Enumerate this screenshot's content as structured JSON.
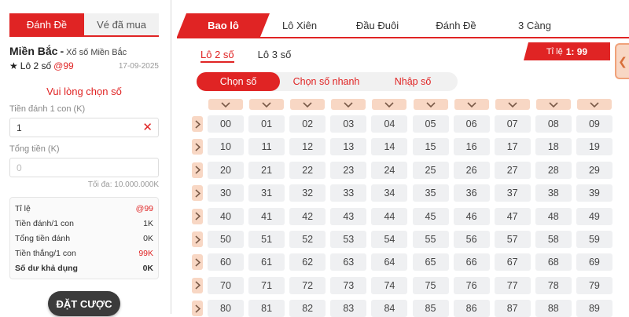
{
  "left": {
    "tabs": [
      {
        "label": "Đánh Đề",
        "active": true
      },
      {
        "label": "Vé đã mua",
        "active": false
      }
    ],
    "region": {
      "name": "Miền Bắc",
      "dash": "-",
      "sub": "Xổ số Miền Bắc"
    },
    "bet_type": {
      "star": "★",
      "label": "Lô 2 số",
      "rate": "@99",
      "date": "17-09-2025"
    },
    "prompt": "Vui lòng chọn số",
    "stake": {
      "label": "Tiền đánh 1 con (K)",
      "value": "1"
    },
    "total": {
      "label": "Tổng tiền (K)",
      "placeholder": "0"
    },
    "max_note": "Tối đa: 10.000.000K",
    "summary": [
      {
        "label": "Tỉ lệ",
        "value": "@99",
        "red": true,
        "bold": false
      },
      {
        "label": "Tiền đánh/1 con",
        "value": "1K",
        "red": false,
        "bold": false
      },
      {
        "label": "Tổng tiền đánh",
        "value": "0K",
        "red": false,
        "bold": false
      },
      {
        "label": "Tiền thắng/1 con",
        "value": "99K",
        "red": true,
        "bold": false
      },
      {
        "label": "Số dư khả dụng",
        "value": "0K",
        "red": false,
        "bold": true
      }
    ],
    "bet_button": "ĐẶT CƯỢC"
  },
  "nav": {
    "tabs": [
      "Bao lô",
      "Lô Xiên",
      "Đầu Đuôi",
      "Đánh Đề",
      "3 Càng"
    ],
    "active": 0
  },
  "subtabs": {
    "items": [
      "Lô 2 số",
      "Lô 3 số"
    ],
    "active": 0
  },
  "ratio": {
    "label": "Tỉ lệ",
    "value": "1: 99"
  },
  "modes": {
    "items": [
      "Chọn số",
      "Chọn số nhanh",
      "Nhập số"
    ],
    "active": 0
  },
  "grid": {
    "rows": [
      [
        "00",
        "01",
        "02",
        "03",
        "04",
        "05",
        "06",
        "07",
        "08",
        "09"
      ],
      [
        "10",
        "11",
        "12",
        "13",
        "14",
        "15",
        "16",
        "17",
        "18",
        "19"
      ],
      [
        "20",
        "21",
        "22",
        "23",
        "24",
        "25",
        "26",
        "27",
        "28",
        "29"
      ],
      [
        "30",
        "31",
        "32",
        "33",
        "34",
        "35",
        "36",
        "37",
        "38",
        "39"
      ],
      [
        "40",
        "41",
        "42",
        "43",
        "44",
        "45",
        "46",
        "47",
        "48",
        "49"
      ],
      [
        "50",
        "51",
        "52",
        "53",
        "54",
        "55",
        "56",
        "57",
        "58",
        "59"
      ],
      [
        "60",
        "61",
        "62",
        "63",
        "64",
        "65",
        "66",
        "67",
        "68",
        "69"
      ],
      [
        "70",
        "71",
        "72",
        "73",
        "74",
        "75",
        "76",
        "77",
        "78",
        "79"
      ],
      [
        "80",
        "81",
        "82",
        "83",
        "84",
        "85",
        "86",
        "87",
        "88",
        "89"
      ]
    ]
  },
  "colors": {
    "accent": "#e02424",
    "peach": "#f8d7c4",
    "cell": "#eff0f2",
    "button_dark": "#3b3b3b"
  },
  "icons": {
    "column": "chevron-down-icon",
    "row": "chevron-right-icon",
    "clear": "close-icon",
    "side": "chevron-left-icon"
  }
}
